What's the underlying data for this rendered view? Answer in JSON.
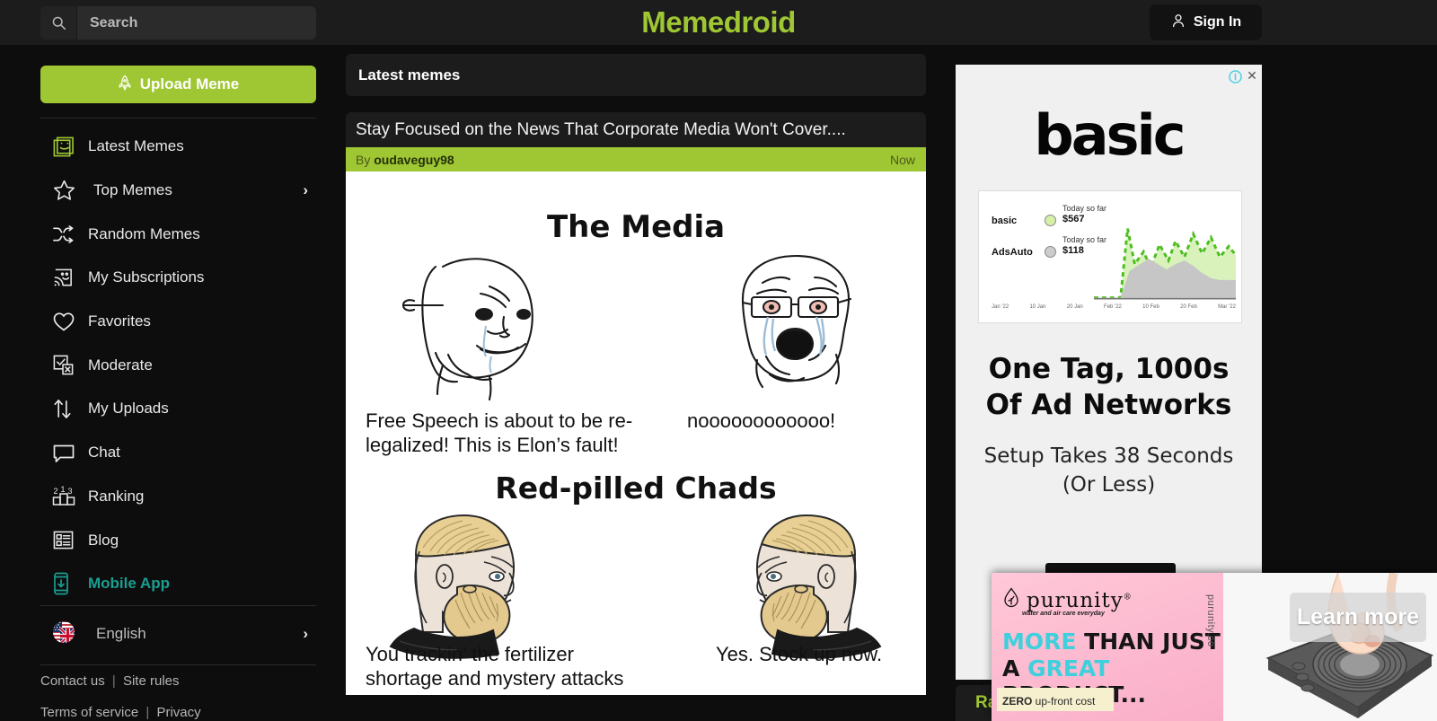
{
  "header": {
    "logo": "Memedroid",
    "search_placeholder": "Search",
    "search_value": "",
    "signin_label": "Sign In",
    "search_icon": "search-icon",
    "user_icon": "user-icon"
  },
  "sidebar": {
    "upload_label": "Upload Meme",
    "upload_icon": "rocket-icon",
    "items": [
      {
        "label": "Latest Memes",
        "icon": "smiley-square-icon",
        "active_icon": true,
        "chevron": false
      },
      {
        "label": "Top Memes",
        "icon": "star-icon",
        "active_icon": false,
        "chevron": true
      },
      {
        "label": "Random Memes",
        "icon": "shuffle-icon",
        "active_icon": false,
        "chevron": false
      },
      {
        "label": "My Subscriptions",
        "icon": "rss-frame-icon",
        "active_icon": false,
        "chevron": false
      },
      {
        "label": "Favorites",
        "icon": "heart-icon",
        "active_icon": false,
        "chevron": false
      },
      {
        "label": "Moderate",
        "icon": "moderate-icon",
        "active_icon": false,
        "chevron": false
      },
      {
        "label": "My Uploads",
        "icon": "up-down-arrow-icon",
        "active_icon": false,
        "chevron": false
      },
      {
        "label": "Chat",
        "icon": "speech-bubble-icon",
        "active_icon": false,
        "chevron": false
      },
      {
        "label": "Ranking",
        "icon": "podium-icon",
        "active_icon": false,
        "chevron": false
      },
      {
        "label": "Blog",
        "icon": "article-list-icon",
        "active_icon": false,
        "chevron": false
      },
      {
        "label": "Mobile App",
        "icon": "phone-download-icon",
        "active_icon": false,
        "chevron": false,
        "highlight": true
      }
    ],
    "language": {
      "label": "English",
      "icon": "flag-icon",
      "chevron": "›"
    },
    "footer": {
      "contact": "Contact us",
      "separator": "|",
      "rules": "Site rules",
      "line2_terms": "Terms of service",
      "line2_privacy": "Privacy"
    },
    "accent_green": "#9fc633",
    "accent_teal": "#1a9e91"
  },
  "main": {
    "panel_title": "Latest memes",
    "meme": {
      "title": "Stay Focused on the News That Corporate Media Won't Cover....",
      "by_prefix": "By",
      "author": "oudaveguy98",
      "time": "Now",
      "image": {
        "top_heading": "The Media",
        "top_left_caption": "Free Speech is about to be re-legalized!  This is Elon’s fault!",
        "top_right_caption": "noooooooooooo!",
        "bottom_heading": "Red-pilled Chads",
        "bottom_left_caption": "You trackin’ the fertilizer shortage and mystery attacks",
        "bottom_right_caption": "Yes.  Stock up now."
      }
    },
    "rate_peek": "Rat"
  },
  "ad_sidebar": {
    "brand": "basic",
    "headline_line1": "One Tag, 1000s",
    "headline_line2": "Of Ad Networks",
    "sub_line1": "Setup Takes 38 Seconds",
    "sub_line2": "(Or Less)",
    "adchoices_icon": "adchoices-info-icon",
    "close_icon": "close-icon",
    "close_glyph": "✕",
    "chart": {
      "rows": [
        {
          "brand": "basic",
          "caption": "Today so far",
          "value": "$567"
        },
        {
          "brand": "AdsAuto",
          "caption": "Today so far",
          "value": "$118"
        }
      ],
      "axis": [
        "Jan '22",
        "10 Jan",
        "20 Jan",
        "Feb '22",
        "10 Feb",
        "20 Feb",
        "Mar '22"
      ]
    }
  },
  "ad_bottom": {
    "brand": "purunity",
    "registered": "®",
    "tagline": "water and air care everyday",
    "headline_1a": "MORE",
    "headline_1b": " THAN JUST",
    "headline_2a": "A ",
    "headline_2b": "GREAT",
    "headline_2c": " PRODUCT...",
    "zero_bold": "ZERO",
    "zero_rest": " up-front cost",
    "vertical_url": "purunity.co",
    "cta_label": "Learn more",
    "cyan": "#3fd0dd"
  }
}
